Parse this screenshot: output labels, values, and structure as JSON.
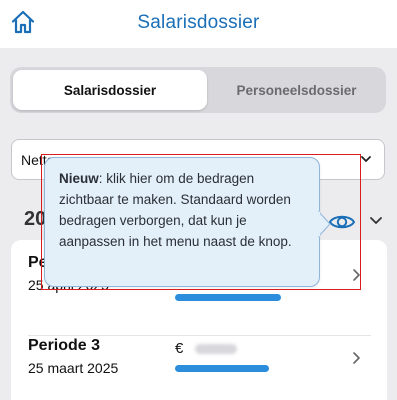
{
  "header": {
    "title": "Salarisdossier",
    "home_icon": "home-icon",
    "accent": "#1a6fb7"
  },
  "tabs": [
    {
      "label": "Salarisdossier",
      "active": true
    },
    {
      "label": "Personeelsdossier",
      "active": false
    }
  ],
  "filter": {
    "selected": "Netto"
  },
  "year_section": {
    "year": "2025",
    "visibility_icon": "eye-icon"
  },
  "periods": [
    {
      "title": "Periode 4",
      "date": "25 april 2025",
      "currency": "€",
      "bar_color": "#2b8ddb"
    },
    {
      "title": "Periode 3",
      "date": "25 maart 2025",
      "currency": "€",
      "bar_color": "#2b8ddb"
    }
  ],
  "tooltip": {
    "keyword": "Nieuw",
    "text": ": klik hier om de bedragen zichtbaar te maken. Standaard worden bedragen verborgen, dat kun je aanpassen in het menu naast de knop.",
    "background": "#e3eff9"
  },
  "highlight_color": "#d91c1c"
}
